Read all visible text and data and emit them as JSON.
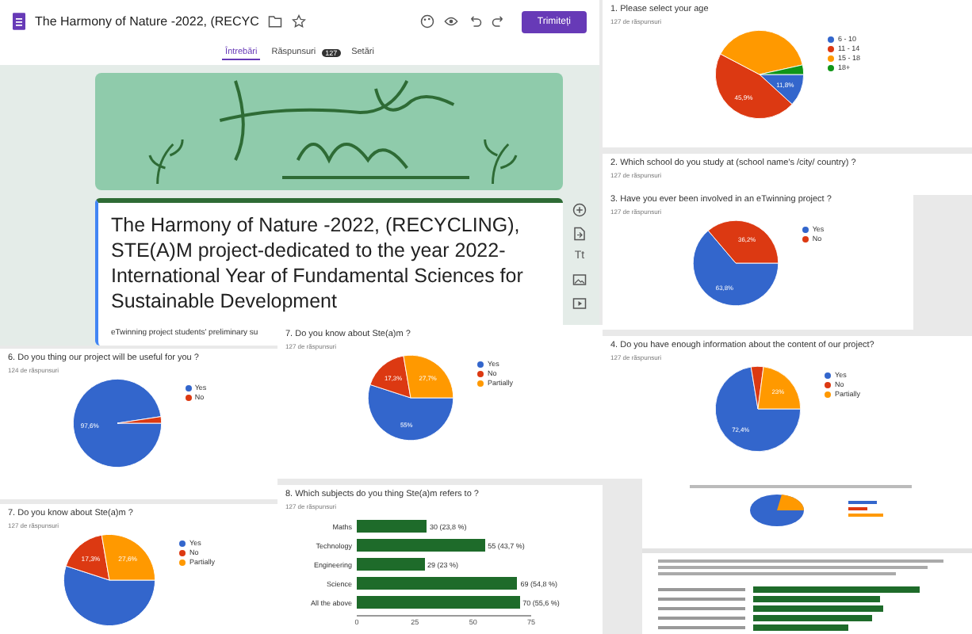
{
  "editor": {
    "title": "The Harmony of Nature -2022, (RECYC",
    "send_button": "Trimiteți",
    "tabs": [
      {
        "label": "Întrebări",
        "selected": true
      },
      {
        "label": "Răspunsuri",
        "selected": false,
        "badge": "127"
      },
      {
        "label": "Setări",
        "selected": false
      }
    ],
    "form_title": "The Harmony of Nature -2022, (RECYCLING), STE(A)M project-dedicated to the year 2022-International Year of Fundamental Sciences for Sustainable Development",
    "description": "eTwinning project students' preliminary su",
    "text_tool": "Tt"
  },
  "summaries": [
    {
      "question": "1. Please select your age",
      "responses": "127 de răspunsuri",
      "legend": [
        {
          "color": "#3366cc"
        },
        {
          "color": "#dc3912"
        },
        {
          "color": "#ff9900"
        },
        {
          "color": "#109618"
        }
      ],
      "chart_data": {
        "type": "pie",
        "categories": [
          "6 - 10",
          "11 - 14",
          "15 - 18",
          "18+"
        ],
        "series": [
          {
            "values": [
              11.8,
              45.9,
              38.8,
              3.5
            ]
          }
        ],
        "value_labels": [
          "11,8%",
          "45,9%",
          null,
          null
        ]
      }
    },
    {
      "question": "2. Which school do you study at (school name's /city/ country) ?",
      "responses": "127 de răspunsuri"
    },
    {
      "question": "3. Have you ever been involved in an eTwinning project ?",
      "responses": "127 de răspunsuri",
      "legend": [
        {
          "color": "#3366cc"
        },
        {
          "color": "#dc3912"
        }
      ],
      "chart_data": {
        "type": "pie",
        "categories": [
          "Yes",
          "No"
        ],
        "series": [
          {
            "values": [
              63.8,
              36.2
            ]
          }
        ],
        "value_labels": [
          "63,8%",
          "36,2%"
        ]
      }
    },
    {
      "question": "6. Do you thing our project will be useful for you ?",
      "responses": "124 de răspunsuri",
      "legend": [
        {
          "color": "#3366cc"
        },
        {
          "color": "#dc3912"
        }
      ],
      "chart_data": {
        "type": "pie",
        "categories": [
          "Yes",
          "No"
        ],
        "series": [
          {
            "values": [
              97.6,
              2.4
            ]
          }
        ],
        "value_labels": [
          "97,6%",
          null
        ]
      }
    },
    {
      "question": "7. Do you know about Ste(a)m ?",
      "responses": "127 de răspunsuri",
      "legend": [
        {
          "color": "#3366cc"
        },
        {
          "color": "#dc3912"
        },
        {
          "color": "#ff9900"
        }
      ],
      "chart_data": {
        "type": "pie",
        "categories": [
          "Yes",
          "No",
          "Partially"
        ],
        "series": [
          {
            "values": [
              55,
              17.3,
              27.7
            ]
          }
        ],
        "value_labels": [
          "55%",
          "17,3%",
          "27,7%"
        ]
      }
    },
    {
      "question": "4. Do you have enough information about the content of our project?",
      "responses": "127 de răspunsuri",
      "legend": [
        {
          "color": "#3366cc"
        },
        {
          "color": "#dc3912"
        },
        {
          "color": "#ff9900"
        }
      ],
      "chart_data": {
        "type": "pie",
        "categories": [
          "Yes",
          "No",
          "Partially"
        ],
        "series": [
          {
            "values": [
              72.4,
              4.7,
              22.9
            ]
          }
        ],
        "value_labels": [
          "72,4%",
          null,
          "23%"
        ]
      }
    },
    {
      "question": "8. Which subjects do you thing Ste(a)m refers to ?",
      "responses": "127 de răspunsuri",
      "chart_data": {
        "type": "bar",
        "orientation": "horizontal",
        "xlim": [
          0,
          75
        ],
        "xticks": [
          0,
          25,
          50,
          75
        ],
        "categories": [
          "Maths",
          "Technology",
          "Engineering",
          "Science",
          "All the above"
        ],
        "series": [
          {
            "color": "#1e6b2a",
            "values": [
              30,
              55,
              29,
              69,
              70
            ]
          }
        ],
        "value_labels": [
          "30 (23,8 %)",
          "55 (43,7 %)",
          "29 (23 %)",
          "69 (54,8 %)",
          "70 (55,6 %)"
        ]
      }
    },
    {
      "question": "7. Do you know about Ste(a)m ?",
      "responses": "127 de răspunsuri",
      "legend": [
        {
          "color": "#3366cc"
        },
        {
          "color": "#dc3912"
        },
        {
          "color": "#ff9900"
        }
      ],
      "chart_data": {
        "type": "pie",
        "categories": [
          "Yes",
          "No",
          "Partially"
        ],
        "series": [
          {
            "values": [
              55,
              17.3,
              27.7
            ]
          }
        ],
        "value_labels": [
          null,
          "17,3%",
          "27,6%"
        ]
      }
    }
  ]
}
